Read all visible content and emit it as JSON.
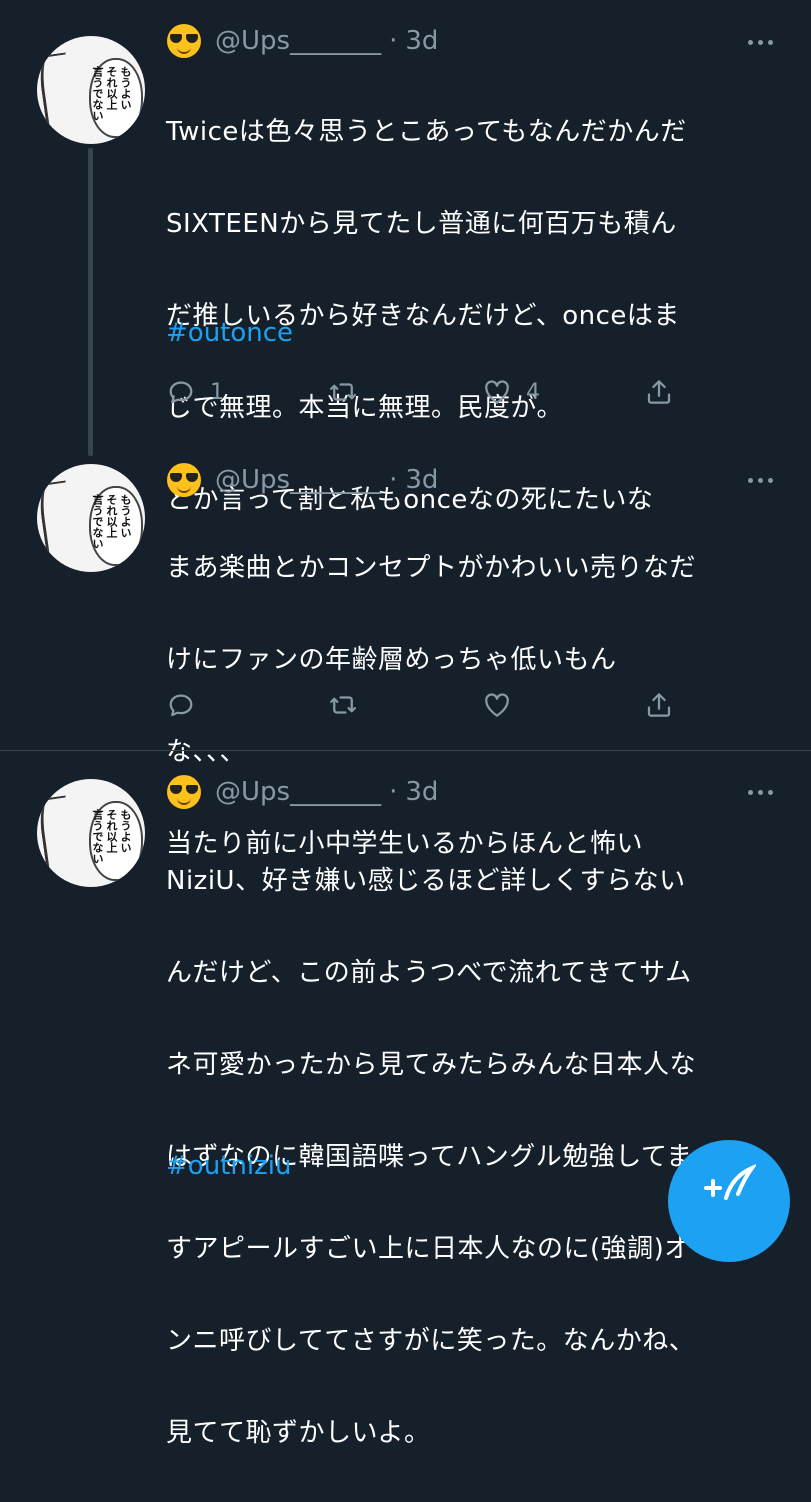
{
  "tweets": [
    {
      "handle": "@Ups_______",
      "separator": "·",
      "time": "3d",
      "lines": [
        "Twiceは色々思うとこあってもなんだかんだ",
        "SIXTEENから見てたし普通に何百万も積ん",
        "だ推しいるから好きなんだけど、onceはま",
        "じで無理。本当に無理。民度が。",
        "とか言って割と私もonceなの死にたいな"
      ],
      "hashtag": "#outonce",
      "reply_count": "1",
      "like_count": "4"
    },
    {
      "handle": "@Ups_______",
      "separator": "·",
      "time": "3d",
      "lines": [
        "まあ楽曲とかコンセプトがかわいい売りなだ",
        "けにファンの年齢層めっちゃ低いもん",
        "な、、、",
        "当たり前に小中学生いるからほんと怖い"
      ]
    },
    {
      "handle": "@Ups_______",
      "separator": "·",
      "time": "3d",
      "lines": [
        "NiziU、好き嫌い感じるほど詳しくすらない",
        "んだけど、この前ようつべで流れてきてサム",
        "ネ可愛かったから見てみたらみんな日本人な",
        "はずなのに韓国語喋ってハングル勉強してま",
        "すアピールすごい上に日本人なのに(強調)オ",
        "ンニ呼びしててさすがに笑った。なんかね、",
        "見てて恥ずかしいよ。"
      ],
      "hashtag": "#outniziu"
    }
  ],
  "avatar_text": [
    "もうよい",
    "それ以上",
    "言うでない"
  ],
  "icons": {
    "avatar": "manga-panel-avatar",
    "emoji": "sunglasses-emoji",
    "more": "more-dots-icon",
    "reply": "reply-icon",
    "retweet": "retweet-icon",
    "like": "heart-icon",
    "share": "share-icon",
    "compose": "compose-tweet-icon"
  },
  "colors": {
    "background": "#15202b",
    "secondary_text": "#8899a6",
    "accent": "#1da1f2",
    "divider": "#38444d"
  }
}
